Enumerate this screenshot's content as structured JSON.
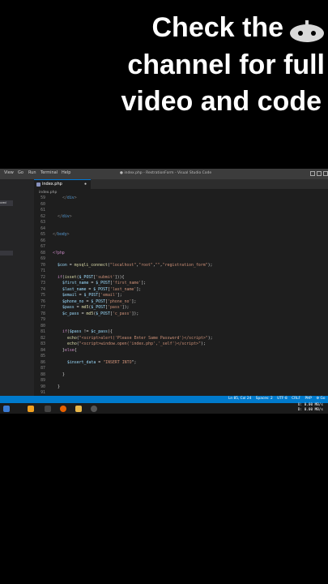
{
  "overlay": {
    "line1": "Check the",
    "line2": "channel for full",
    "line3": "video and code"
  },
  "window": {
    "menu": [
      "View",
      "Go",
      "Run",
      "Terminal",
      "Help"
    ],
    "title": "● index.php - RestrationForm - Visual Studio Code"
  },
  "sidebar": {
    "selected_label": "oved"
  },
  "tab": {
    "label": "index.php",
    "close": "●"
  },
  "breadcrumb": "index.php",
  "code_lines": [
    {
      "n": "59",
      "indent": 2,
      "html": "<span class='tag'>&lt;/<b>div</b>&gt;</span>"
    },
    {
      "n": "60",
      "indent": 0,
      "html": ""
    },
    {
      "n": "61",
      "indent": 0,
      "html": ""
    },
    {
      "n": "62",
      "indent": 1,
      "html": "<span class='tag'>&lt;/<b>div</b>&gt;</span>"
    },
    {
      "n": "63",
      "indent": 0,
      "html": ""
    },
    {
      "n": "64",
      "indent": 0,
      "html": ""
    },
    {
      "n": "65",
      "indent": 0,
      "html": "<span class='tag'>&lt;/<b>body</b>&gt;</span>"
    },
    {
      "n": "66",
      "indent": 0,
      "html": ""
    },
    {
      "n": "67",
      "indent": 0,
      "html": ""
    },
    {
      "n": "68",
      "indent": 0,
      "html": "<span class='kw'>&lt;?php</span>"
    },
    {
      "n": "69",
      "indent": 0,
      "html": ""
    },
    {
      "n": "70",
      "indent": 1,
      "html": "<span class='var'>$con</span> = <span class='fn'>mysqli_connect</span>(<span class='str'>\"localhost\"</span>,<span class='str'>\"root\"</span>,<span class='str'>\"\"</span>,<span class='str'>\"registration_form\"</span>);"
    },
    {
      "n": "71",
      "indent": 0,
      "html": ""
    },
    {
      "n": "72",
      "indent": 1,
      "html": "<span class='kw'>if</span>(<span class='fn'>isset</span>(<span class='var'>$_POST</span>[<span class='str'>'submit'</span>])){"
    },
    {
      "n": "73",
      "indent": 2,
      "html": "<span class='var'>$first_name</span> = <span class='var'>$_POST</span>[<span class='str'>'first_name'</span>];"
    },
    {
      "n": "74",
      "indent": 2,
      "html": "<span class='var'>$last_name</span> = <span class='var'>$_POST</span>[<span class='str'>'last_name'</span>];"
    },
    {
      "n": "75",
      "indent": 2,
      "html": "<span class='var'>$email</span> = <span class='var'>$_POST</span>[<span class='str'>'email'</span>];"
    },
    {
      "n": "76",
      "indent": 2,
      "html": "<span class='var'>$phone_no</span> = <span class='var'>$_POST</span>[<span class='str'>'phone_no'</span>];"
    },
    {
      "n": "77",
      "indent": 2,
      "html": "<span class='var'>$pass</span> = <span class='fn'>md5</span>(<span class='var'>$_POST</span>[<span class='str'>'pass'</span>]);"
    },
    {
      "n": "78",
      "indent": 2,
      "html": "<span class='var'>$c_pass</span> = <span class='fn'>md5</span>(<span class='var'>$_POST</span>[<span class='str'>'c_pass'</span>]);"
    },
    {
      "n": "79",
      "indent": 0,
      "html": ""
    },
    {
      "n": "80",
      "indent": 0,
      "html": ""
    },
    {
      "n": "81",
      "indent": 2,
      "html": "<span class='kw'>if</span>(<span class='var'>$pass</span> != <span class='var'>$c_pass</span>){"
    },
    {
      "n": "82",
      "indent": 3,
      "html": "<span class='fn'>echo</span>(<span class='str'>\"&lt;script&gt;alert('Please Enter Same Password')&lt;/script&gt;\"</span>);"
    },
    {
      "n": "83",
      "indent": 3,
      "html": "<span class='fn'>echo</span>(<span class='str'>\"&lt;script&gt;window.open('index.php','_self')&lt;/script&gt;\"</span>);"
    },
    {
      "n": "84",
      "indent": 2,
      "html": "}<span class='kw'>else</span>{"
    },
    {
      "n": "85",
      "indent": 0,
      "html": ""
    },
    {
      "n": "86",
      "indent": 3,
      "html": "<span class='var'>$insert_data</span> = <span class='str'>\"INSERT INTO</span>\";"
    },
    {
      "n": "87",
      "indent": 0,
      "html": ""
    },
    {
      "n": "88",
      "indent": 2,
      "html": "}"
    },
    {
      "n": "89",
      "indent": 0,
      "html": ""
    },
    {
      "n": "90",
      "indent": 1,
      "html": "}"
    },
    {
      "n": "91",
      "indent": 0,
      "html": ""
    }
  ],
  "status": "Ln 85, Col 24    Spaces: 2    UTF-8    CRLF    PHP    ⚙ Go",
  "network": {
    "up_label": "U:",
    "up": "0.00 MB/s",
    "down_label": "D:",
    "down": "0.00 MB/s"
  },
  "colors": {
    "statusbar": "#007acc",
    "editor_bg": "#1e1e1e"
  }
}
